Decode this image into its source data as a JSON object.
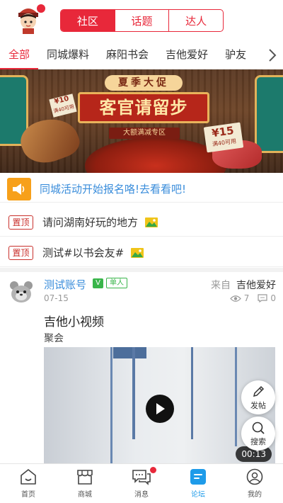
{
  "header": {
    "segments": [
      "社区",
      "话题",
      "达人"
    ],
    "active_segment": 0
  },
  "categories": {
    "items": [
      "全部",
      "同城爆料",
      "麻阳书会",
      "吉他爱好",
      "驴友"
    ],
    "active": 0
  },
  "banner": {
    "top_text": "夏季大促",
    "main_text": "客官请留步",
    "sub_text": "大额满减专区",
    "price_left_big": "¥10",
    "price_left_small": "满40可用",
    "price_right_big": "¥15",
    "price_right_small": "满40可用"
  },
  "notice": {
    "text": "同城活动开始报名咯!去看看吧!"
  },
  "pinned": [
    {
      "badge": "置顶",
      "text": "请问湖南好玩的地方"
    },
    {
      "badge": "置顶",
      "text": "测试#以书会友#"
    }
  ],
  "post": {
    "username": "测试账号",
    "v_badge": "V",
    "role": "单人",
    "from_label": "来自",
    "from_value": "吉他爱好",
    "date": "07-15",
    "views": "7",
    "comments": "0",
    "title": "吉他小视频",
    "subtitle": "聚会",
    "video_duration": "00:13"
  },
  "fabs": {
    "post_label": "发帖",
    "search_label": "搜索"
  },
  "bottom_nav": {
    "items": [
      "首页",
      "商城",
      "消息",
      "论坛",
      "我的"
    ],
    "active": 3
  },
  "colors": {
    "brand_red": "#e8283a",
    "link_blue": "#3a8ddb",
    "nav_active_blue": "#1e9be9",
    "badge_green": "#39b54a",
    "notice_orange": "#f7a01a"
  }
}
